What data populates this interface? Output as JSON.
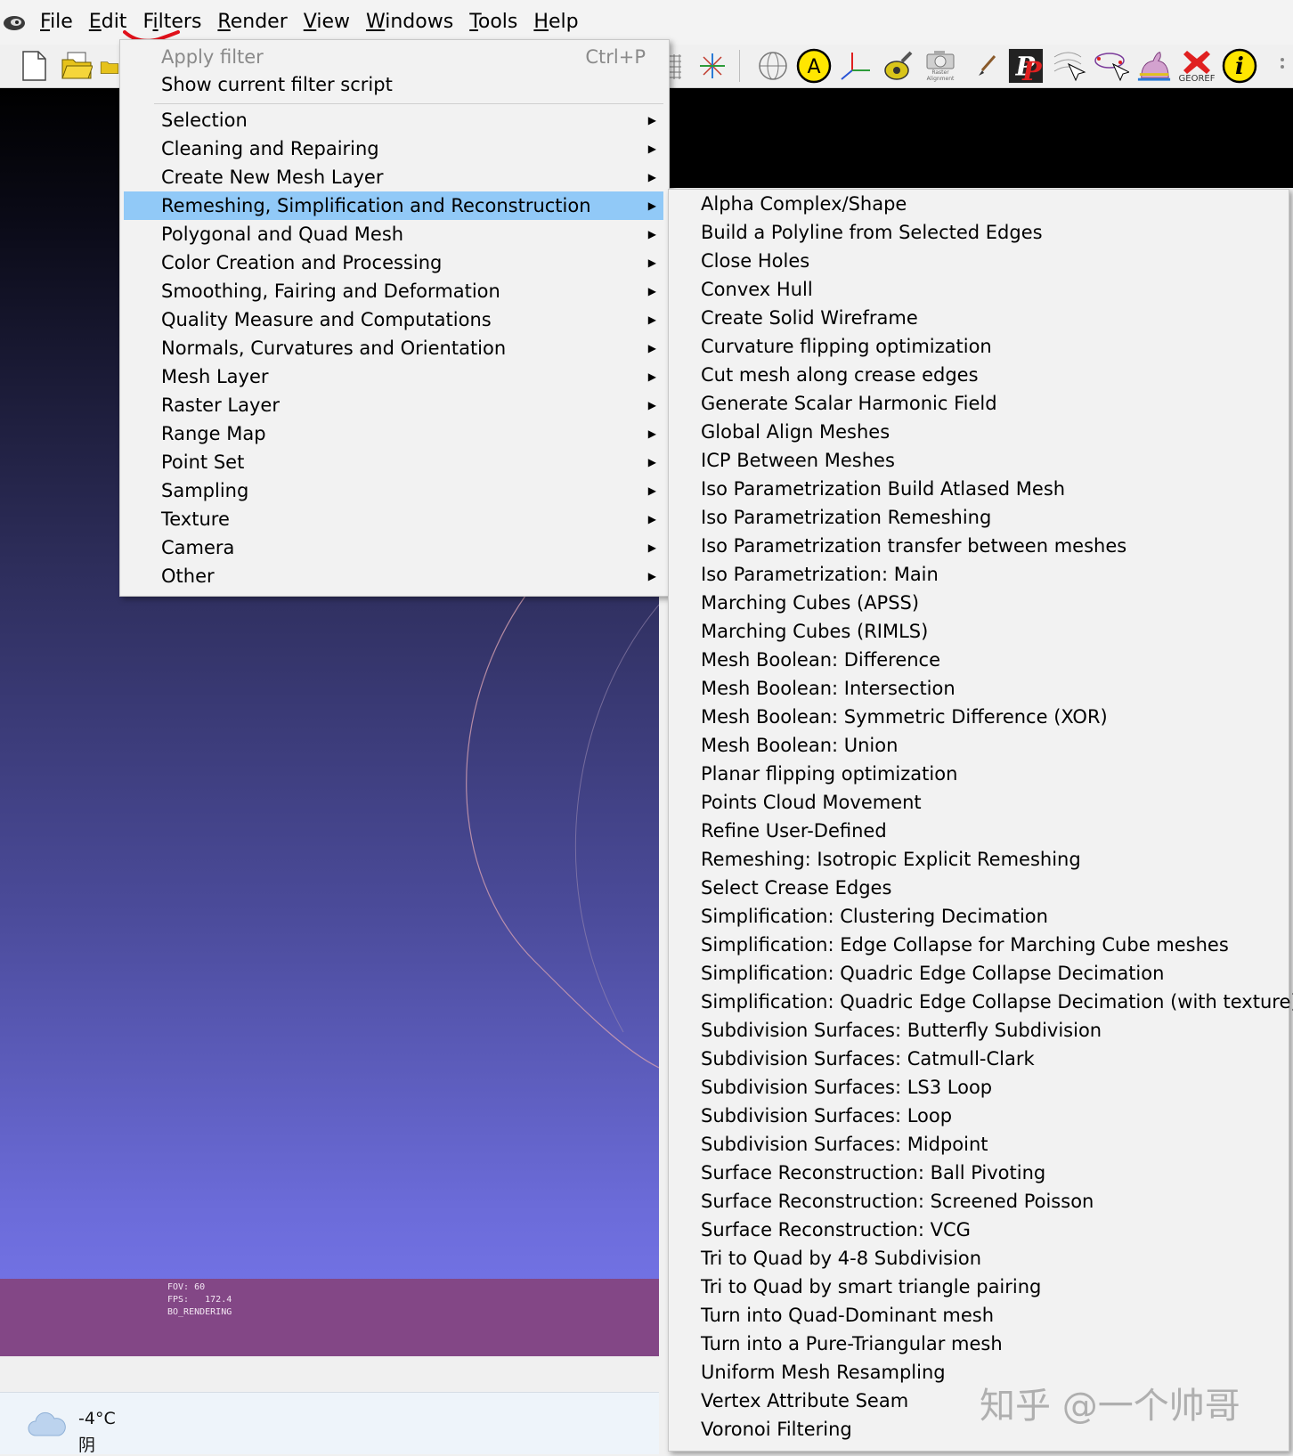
{
  "menubar": {
    "items": [
      {
        "acc": "F",
        "rest": "ile"
      },
      {
        "acc": "E",
        "rest": "dit"
      },
      {
        "pre": "F",
        "acc": "i",
        "rest": "lters"
      },
      {
        "acc": "R",
        "rest": "ender"
      },
      {
        "acc": "V",
        "rest": "iew"
      },
      {
        "acc": "W",
        "rest": "indows"
      },
      {
        "acc": "T",
        "rest": "ools"
      },
      {
        "acc": "H",
        "rest": "elp"
      }
    ]
  },
  "toolbar": {
    "icons": [
      "new-file-icon",
      "open-folder-icon",
      "open-project-icon",
      "mesh-grid-icon",
      "axis-gizmo-icon",
      "sphere-wireframe-icon",
      "annotation-a-icon",
      "axes-icon",
      "measure-tape-icon",
      "raster-alignment-icon",
      "paint-brush-icon",
      "pickpoints-icon",
      "select-vertices-icon",
      "select-faces-icon",
      "bunny-edit-icon",
      "georef-icon",
      "info-icon"
    ],
    "raster_label": "Raster Alignment",
    "georef_label": "GEOREF",
    "annotation_letter": "A",
    "info_letter": "i",
    "pp_letter": "P"
  },
  "filters_menu": {
    "apply_filter": "Apply filter",
    "apply_shortcut": "Ctrl+P",
    "show_script": "Show current filter script",
    "categories": [
      "Selection",
      "Cleaning and Repairing",
      "Create New Mesh Layer",
      "Remeshing, Simplification and Reconstruction",
      "Polygonal and Quad Mesh",
      "Color Creation and Processing",
      "Smoothing, Fairing and Deformation",
      "Quality Measure and Computations",
      "Normals, Curvatures and Orientation",
      "Mesh Layer",
      "Raster Layer",
      "Range Map",
      "Point Set",
      "Sampling",
      "Texture",
      "Camera",
      "Other"
    ],
    "highlighted": "Remeshing, Simplification and Reconstruction"
  },
  "submenu": {
    "items": [
      "Alpha Complex/Shape",
      "Build a Polyline from Selected Edges",
      "Close Holes",
      "Convex Hull",
      "Create Solid Wireframe",
      "Curvature flipping optimization",
      "Cut mesh along crease edges",
      "Generate Scalar Harmonic Field",
      "Global Align Meshes",
      "ICP Between Meshes",
      "Iso Parametrization Build Atlased Mesh",
      "Iso Parametrization Remeshing",
      "Iso Parametrization transfer between meshes",
      "Iso Parametrization: Main",
      "Marching Cubes (APSS)",
      "Marching Cubes (RIMLS)",
      "Mesh Boolean: Difference",
      "Mesh Boolean: Intersection",
      "Mesh Boolean: Symmetric Difference (XOR)",
      "Mesh Boolean: Union",
      "Planar flipping optimization",
      "Points Cloud Movement",
      "Refine User-Defined",
      "Remeshing: Isotropic Explicit Remeshing",
      "Select Crease Edges",
      "Simplification: Clustering Decimation",
      "Simplification: Edge Collapse for Marching Cube meshes",
      "Simplification: Quadric Edge Collapse Decimation",
      "Simplification: Quadric Edge Collapse Decimation (with texture)",
      "Subdivision Surfaces: Butterfly Subdivision",
      "Subdivision Surfaces: Catmull-Clark",
      "Subdivision Surfaces: LS3 Loop",
      "Subdivision Surfaces: Loop",
      "Subdivision Surfaces: Midpoint",
      "Surface Reconstruction: Ball Pivoting",
      "Surface Reconstruction: Screened Poisson",
      "Surface Reconstruction: VCG",
      "Tri to Quad by 4-8 Subdivision",
      "Tri to Quad by smart triangle pairing",
      "Turn into Quad-Dominant mesh",
      "Turn into a Pure-Triangular mesh",
      "Uniform Mesh Resampling",
      "Vertex Attribute Seam",
      "Voronoi Filtering"
    ]
  },
  "viewport": {
    "info_lines": [
      "FOV: 60",
      "FPS:   172.4",
      "BO_RENDERING"
    ]
  },
  "taskbar": {
    "temperature": "-4°C",
    "condition": "阴"
  },
  "watermark": "知乎 @一个帅哥",
  "colors": {
    "highlight": "#91c9f7",
    "infobar": "#834786",
    "annotation_yellow": "#ffe600",
    "filters_mark": "#e0101a"
  }
}
